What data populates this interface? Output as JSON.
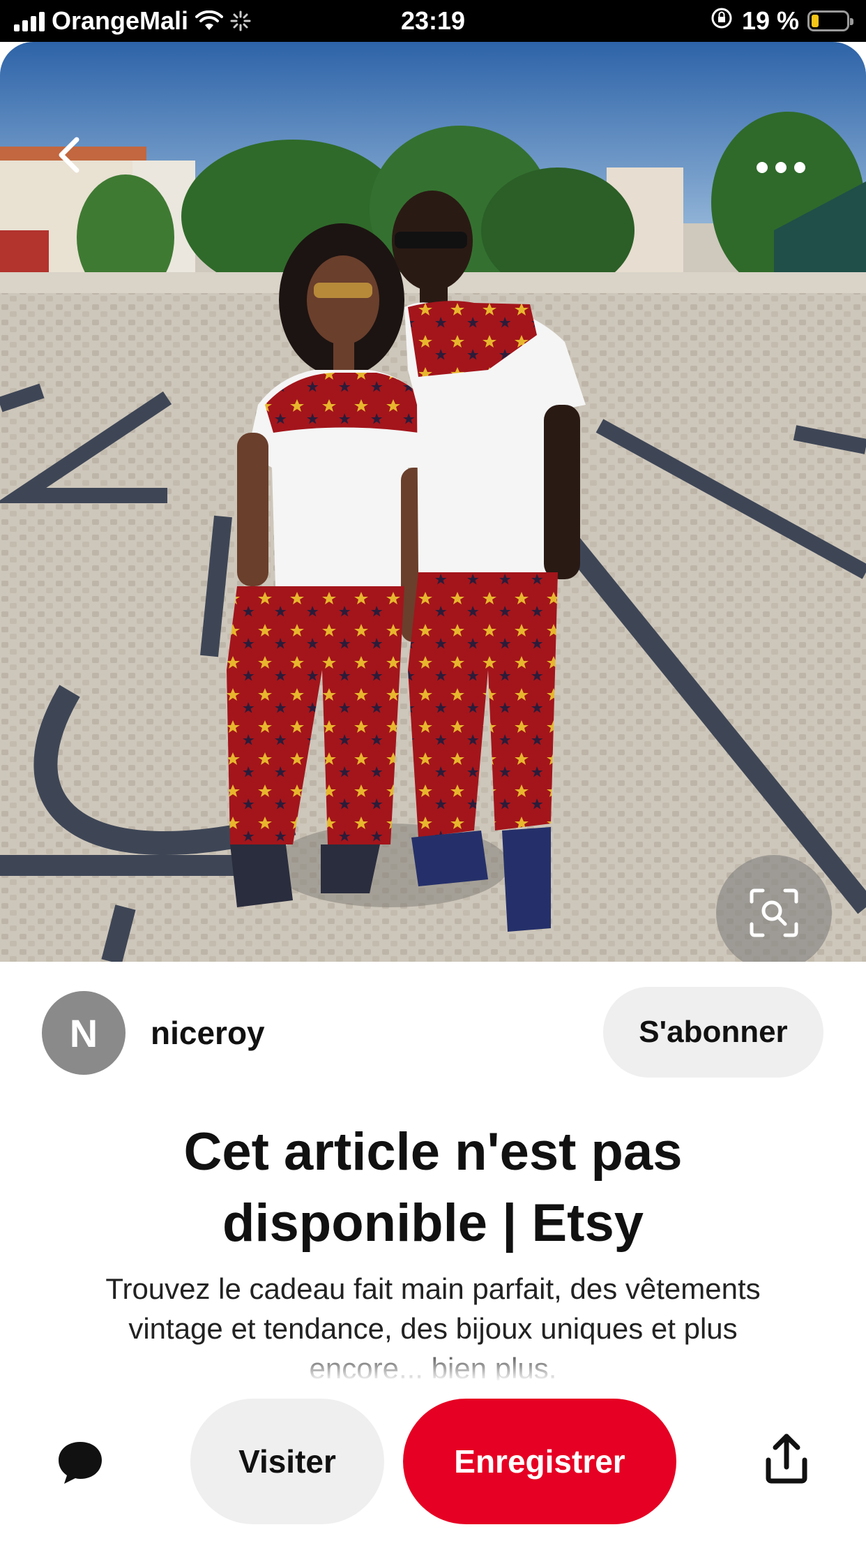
{
  "status_bar": {
    "carrier": "OrangeMali",
    "time": "23:19",
    "battery_percent": "19 %",
    "battery_level": 0.19
  },
  "pin": {
    "image_icons": {
      "back": "chevron-left-icon",
      "more": "more-horizontal-icon",
      "visual_search": "visual-search-icon"
    },
    "creator": {
      "avatar_initial": "N",
      "name": "niceroy",
      "follow_label": "S'abonner"
    },
    "title": "Cet article n'est pas disponible | Etsy",
    "description": "Trouvez le cadeau fait main parfait, des vêtements vintage et tendance, des bijoux uniques et plus encore... bien plus."
  },
  "action_bar": {
    "comment_icon": "comment-icon",
    "visit_label": "Visiter",
    "save_label": "Enregistrer",
    "share_icon": "share-icon",
    "save_color": "#e60023"
  }
}
